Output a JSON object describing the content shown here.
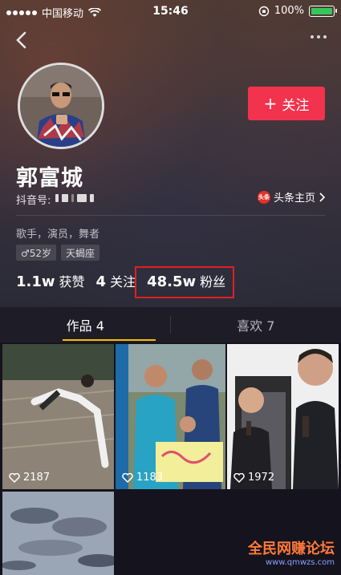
{
  "status_bar": {
    "carrier": "中国移动",
    "time": "15:46",
    "battery": "100%"
  },
  "profile": {
    "follow_button": "关注",
    "name": "郭富城",
    "douyin_id_label": "抖音号:",
    "toutiao_badge": "头条",
    "toutiao_link": "头条主页",
    "bio": "歌手，演员，舞者",
    "tags": [
      "♂52岁",
      "天蝎座"
    ]
  },
  "stats": {
    "likes_count": "1.1w",
    "likes_label": "获赞",
    "following_count": "4",
    "following_label": "关注",
    "fans_count": "48.5w",
    "fans_label": "粉丝"
  },
  "tabs": [
    {
      "label": "作品 4"
    },
    {
      "label": "喜欢 7"
    }
  ],
  "videos": [
    {
      "likes": "2187"
    },
    {
      "likes": "1183"
    },
    {
      "likes": "1972"
    },
    {
      "likes": ""
    }
  ],
  "watermark": {
    "title": "全民网赚论坛",
    "url": "www.qmwzs.com"
  }
}
